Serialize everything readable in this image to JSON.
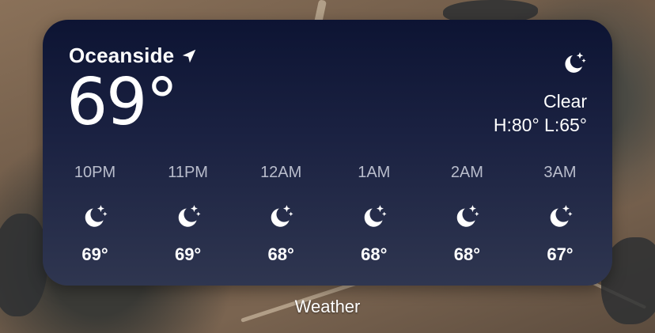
{
  "widget": {
    "location": "Oceanside",
    "location_icon": "location-arrow-icon",
    "current_temp": "69°",
    "condition_icon": "moon-stars-icon",
    "condition": "Clear",
    "high_low": "H:80° L:65°",
    "hourly": [
      {
        "time": "10PM",
        "icon": "moon-stars-icon",
        "temp": "69°"
      },
      {
        "time": "11PM",
        "icon": "moon-stars-icon",
        "temp": "69°"
      },
      {
        "time": "12AM",
        "icon": "moon-stars-icon",
        "temp": "68°"
      },
      {
        "time": "1AM",
        "icon": "moon-stars-icon",
        "temp": "68°"
      },
      {
        "time": "2AM",
        "icon": "moon-stars-icon",
        "temp": "68°"
      },
      {
        "time": "3AM",
        "icon": "moon-stars-icon",
        "temp": "67°"
      }
    ]
  },
  "app_label": "Weather",
  "colors": {
    "widget_top": "#0d1433",
    "widget_bottom": "#2f3650",
    "text": "#ffffff",
    "time_text": "#b9bdcc"
  }
}
